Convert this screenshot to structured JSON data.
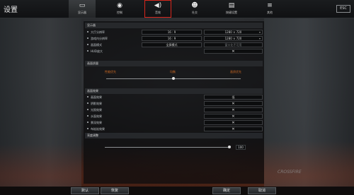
{
  "window": {
    "title": "设置",
    "close_label": "ESC"
  },
  "tabs": [
    {
      "label": "显示器",
      "icon": "monitor-icon"
    },
    {
      "label": "控制",
      "icon": "gamepad-icon"
    },
    {
      "label": "音效",
      "icon": "speaker-icon"
    },
    {
      "label": "社交",
      "icon": "people-icon"
    },
    {
      "label": "按键设置",
      "icon": "keyboard-icon"
    },
    {
      "label": "其他",
      "icon": "list-icon"
    }
  ],
  "display": {
    "section_title": "显示器",
    "rows": [
      {
        "label": "大厅分辨率",
        "ratio": "16 : 9",
        "resolution": "1280 × 720"
      },
      {
        "label": "游戏内分辨率",
        "ratio": "16 : 9",
        "resolution": "1280 × 720"
      },
      {
        "label": "画面模式",
        "ratio": "全屏模式",
        "resolution": "窗口化不可用"
      },
      {
        "label": "HUD放大",
        "ratio": "",
        "resolution": "✕"
      }
    ]
  },
  "quality": {
    "section_title": "画面质量",
    "marks": [
      "性能优先",
      "均衡",
      "画质优先"
    ],
    "level": 0.5
  },
  "effects": {
    "section_title": "画面效果",
    "rows": [
      {
        "label": "画面效果",
        "value": "低"
      },
      {
        "label": "阴影效果",
        "value": "✕"
      },
      {
        "label": "光照效果",
        "value": "✕"
      },
      {
        "label": "水面效果",
        "value": "✕"
      },
      {
        "label": "景深效果",
        "value": "✕"
      },
      {
        "label": "布娃娃效果",
        "value": "✕"
      }
    ]
  },
  "brightness": {
    "section_title": "亮度调整",
    "value": "100",
    "level": 1.0
  },
  "buttons": {
    "default": "默认",
    "reset": "恢复",
    "confirm": "确定",
    "cancel": "取消"
  },
  "watermark": "CROSSFIRE"
}
